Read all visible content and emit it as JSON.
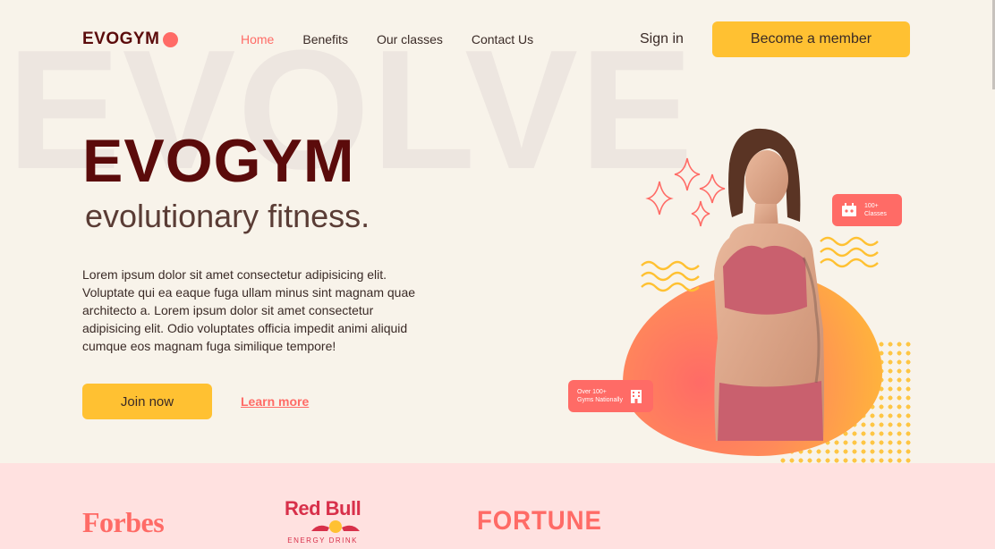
{
  "background_word": "EVOLVE",
  "brand": {
    "name": "EVOGYM"
  },
  "nav": {
    "links": [
      {
        "label": "Home",
        "active": true
      },
      {
        "label": "Benefits",
        "active": false
      },
      {
        "label": "Our classes",
        "active": false
      },
      {
        "label": "Contact Us",
        "active": false
      }
    ],
    "signin": "Sign in",
    "cta": "Become a member"
  },
  "hero": {
    "title": "EVOGYM",
    "subtitle": "evolutionary fitness.",
    "body": "Lorem ipsum dolor sit amet consectetur adipisicing elit. Voluptate qui ea eaque fuga ullam minus sint magnam quae architecto a. Lorem ipsum dolor sit amet consectetur adipisicing elit. Odio voluptates officia impedit animi aliquid cumque eos magnam fuga similique tempore!",
    "join_button": "Join now",
    "learn_more": "Learn more"
  },
  "badges": {
    "classes": {
      "line1": "100+",
      "line2": "Classes"
    },
    "gyms": {
      "line1": "Over 100+",
      "line2": "Gyms Nationally"
    }
  },
  "sponsors": {
    "forbes": "Forbes",
    "redbull": {
      "name": "Red Bull",
      "sub": "ENERGY DRINK"
    },
    "fortune": "FORTUNE"
  },
  "colors": {
    "background": "#f8f3ea",
    "primary": "#ff6b66",
    "secondary": "#ffc132",
    "brand_dark": "#5b0b0b",
    "sponsor_band": "#ffe1e0"
  }
}
